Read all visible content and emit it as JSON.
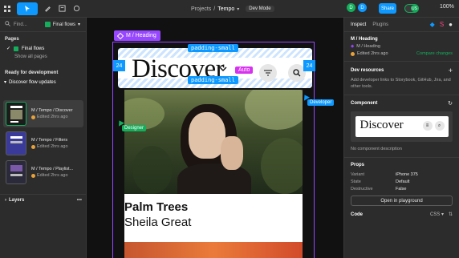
{
  "topbar": {
    "breadcrumb_parent": "Projects",
    "breadcrumb_sep": "/",
    "breadcrumb_current": "Tempo",
    "mode_badge": "Dev Mode",
    "avatars": [
      {
        "letter": "D",
        "color": "#14ae5c"
      },
      {
        "letter": "D",
        "color": "#0d99ff"
      }
    ],
    "share_label": "Share",
    "user_initials": "US",
    "zoom_label": "100%"
  },
  "left": {
    "search_placeholder": "Find...",
    "flow_filter": "Final flows",
    "pages_heading": "Pages",
    "pages": [
      {
        "label": "Final flows",
        "selected": true
      },
      {
        "label": "Show all pages",
        "selected": false
      }
    ],
    "ready_heading": "Ready for development",
    "flow_group": "Discover flow updates",
    "flow_items": [
      {
        "title": "M / Tempo / Discover",
        "meta": "Edited 2hrs ago"
      },
      {
        "title": "M / Tempo / Filters",
        "meta": "Edited 2hrs ago"
      },
      {
        "title": "M / Tempo / Playlist...",
        "meta": "Edited 2hrs ago"
      }
    ],
    "layers_label": "Layers"
  },
  "canvas": {
    "annotation_label": "M / Heading",
    "padding_top": "padding-small",
    "padding_bottom": "padding-small",
    "side_left": "24",
    "side_right": "24",
    "heading_text": "Discover",
    "auto_label": "Auto",
    "card_title": "Palm Trees",
    "card_subtitle": "Sheila Great",
    "cursor_developer": "Developer",
    "cursor_designer": "Designer"
  },
  "right": {
    "tab_inspect": "Inspect",
    "tab_plugins": "Plugins",
    "component_title": "M / Heading",
    "component_path": "M / Heading",
    "edited": "Edited 2hrs ago",
    "compare_link": "Compare changes",
    "dev_resources_heading": "Dev resources",
    "dev_resources_text": "Add developer links to Storybook, GitHub, Jira, and other tools.",
    "component_heading": "Component",
    "preview_text": "Discover",
    "no_description": "No component description",
    "props_heading": "Props",
    "props": [
      {
        "key": "Variant",
        "value": "iPhone 375"
      },
      {
        "key": "State",
        "value": "Default"
      },
      {
        "key": "Destructive",
        "value": "False"
      }
    ],
    "playground_label": "Open in playground",
    "code_heading": "Code",
    "code_lang": "CSS"
  },
  "colors": {
    "accent": "#0d99ff",
    "component": "#9747ff",
    "success": "#14ae5c",
    "auto": "#d633ee"
  }
}
